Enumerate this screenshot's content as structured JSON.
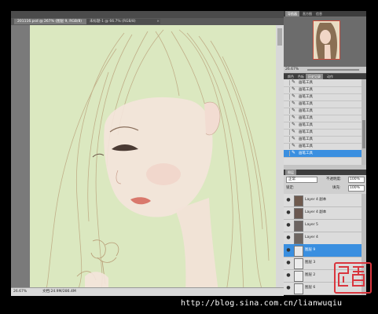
{
  "document": {
    "tabs": [
      {
        "label": "201116.psd @ 267% (图层 9, RGB/8)",
        "active": true
      },
      {
        "label": "未标题-1 @ 66.7% (RGB/8)",
        "active": false
      }
    ]
  },
  "status": {
    "zoom": "26.67%",
    "doc_size": "文档:24.9M/286.4M"
  },
  "navigator": {
    "tabs": [
      "导航器",
      "直方图",
      "信息"
    ],
    "zoom": "26.67%"
  },
  "history": {
    "tabs": [
      "颜色",
      "色板",
      "历史记录",
      "动作"
    ],
    "items": [
      {
        "label": "画笔工具",
        "selected": false
      },
      {
        "label": "画笔工具",
        "selected": false
      },
      {
        "label": "画笔工具",
        "selected": false
      },
      {
        "label": "画笔工具",
        "selected": false
      },
      {
        "label": "画笔工具",
        "selected": false
      },
      {
        "label": "画笔工具",
        "selected": false
      },
      {
        "label": "画笔工具",
        "selected": false
      },
      {
        "label": "画笔工具",
        "selected": false
      },
      {
        "label": "画笔工具",
        "selected": false
      },
      {
        "label": "画笔工具",
        "selected": false
      },
      {
        "label": "画笔工具",
        "selected": true
      }
    ]
  },
  "layers": {
    "tab": "图层",
    "blend_mode": "正常",
    "opacity_label": "不透明度:",
    "opacity_value": "100%",
    "lock_label": "锁定:",
    "fill_label": "填充:",
    "fill_value": "100%",
    "items": [
      {
        "name": "Layer 4 副本",
        "selected": false,
        "thumb_color": "#6e5a4e"
      },
      {
        "name": "Layer 4 副本",
        "selected": false,
        "thumb_color": "#6a5850"
      },
      {
        "name": "Layer 5",
        "selected": false,
        "thumb_color": "#6b6360"
      },
      {
        "name": "Layer 4",
        "selected": false,
        "thumb_color": "#6e6661"
      },
      {
        "name": "图层 9",
        "selected": true,
        "thumb_color": "#e8e8e8"
      },
      {
        "name": "图层 3",
        "selected": false,
        "thumb_color": "#ececec"
      },
      {
        "name": "图层 2",
        "selected": false,
        "thumb_color": "#ececec"
      },
      {
        "name": "图层 6",
        "selected": false,
        "thumb_color": "#ececec"
      }
    ]
  },
  "watermark": {
    "url": "http://blog.sina.com.cn/lianwuqiu",
    "seal_text": "舞秋"
  },
  "colors": {
    "accent": "#3a8fe0",
    "canvas_bg": "#dbe8c0",
    "seal": "#d9363e"
  }
}
